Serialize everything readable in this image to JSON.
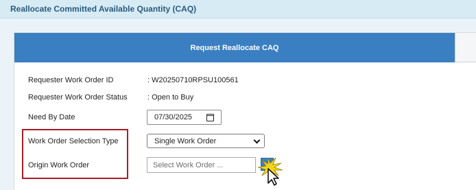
{
  "header": {
    "title": "Reallocate Committed Available Quantity (CAQ)"
  },
  "tab": {
    "label": "Request Reallocate CAQ"
  },
  "form": {
    "requester_work_order_id": {
      "label": "Requester Work Order ID",
      "value": ": W20250710RPSU100561"
    },
    "requester_work_order_status": {
      "label": "Requester Work Order Status",
      "value": ": Open to Buy"
    },
    "need_by_date": {
      "label": "Need By Date",
      "value": "07/30/2025"
    },
    "work_order_selection_type": {
      "label": "Work Order Selection Type",
      "value": "Single Work Order"
    },
    "origin_work_order": {
      "label": "Origin Work Order",
      "placeholder": "Select Work Order ..."
    }
  },
  "colors": {
    "tab_active": "#3a7fc1",
    "highlight": "#a81c24",
    "header_bg": "#d7ebf5",
    "title_text": "#2a5a7c"
  },
  "icons": {
    "date_picker": "calendar-icon",
    "select_arrow": "chevron-down-icon",
    "lookup": "lookup-icon",
    "cursor": "mouse-pointer-icon",
    "click_burst": "click-burst-icon"
  }
}
